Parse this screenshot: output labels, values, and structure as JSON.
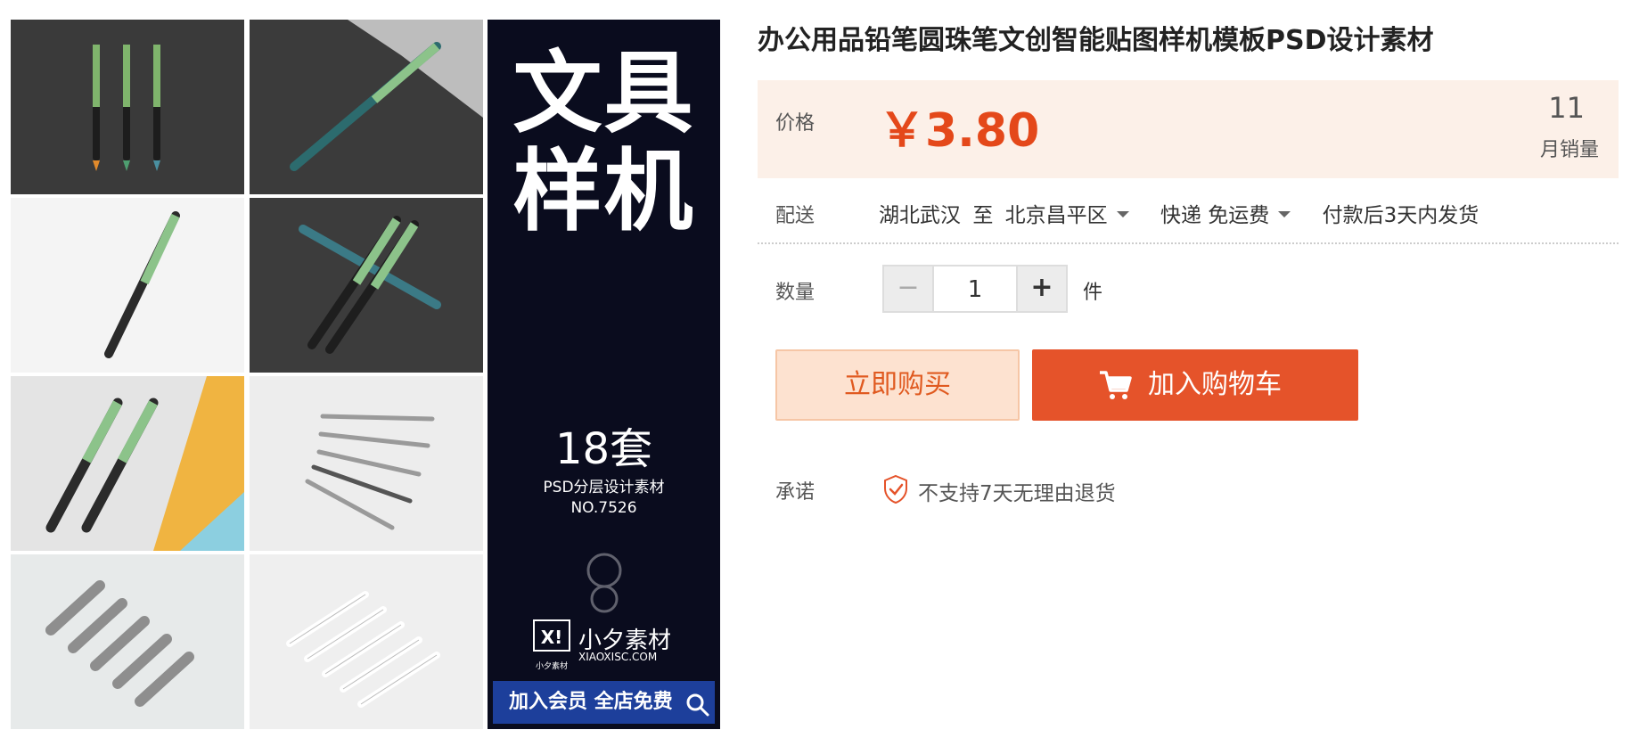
{
  "banner": {
    "big_line1": "文具",
    "big_line2": "样机",
    "count": "18套",
    "subtitle": "PSD分层设计素材",
    "number": "NO.7526",
    "logo_caption": "小夕素材",
    "brand": "小夕素材",
    "url": "XIAOXISC.COM",
    "member": "加入会员 全店免费",
    "bg_color": "#0a0c1e"
  },
  "product": {
    "title": "办公用品铅笔圆珠笔文创智能贴图样机模板PSD设计素材",
    "price_label": "价格",
    "price": "￥3.80",
    "sales_count": "11",
    "sales_label": "月销量",
    "delivery_label": "配送",
    "delivery_from": "湖北武汉",
    "delivery_to_word": "至",
    "delivery_dest": "北京昌平区",
    "shipping": "快递 免运费",
    "dispatch": "付款后3天内发货",
    "qty_label": "数量",
    "qty_minus": "−",
    "qty_value": "1",
    "qty_plus": "+",
    "qty_unit": "件",
    "buy_now": "立即购买",
    "add_cart": "加入购物车",
    "promise_label": "承诺",
    "promise_text": "不支持7天无理由退货",
    "accent_color": "#e5532a"
  },
  "icons": {
    "zoom": "magnifier-icon",
    "cart": "cart-icon",
    "promise": "shield-check-icon",
    "dropdown": "caret-down-icon"
  }
}
